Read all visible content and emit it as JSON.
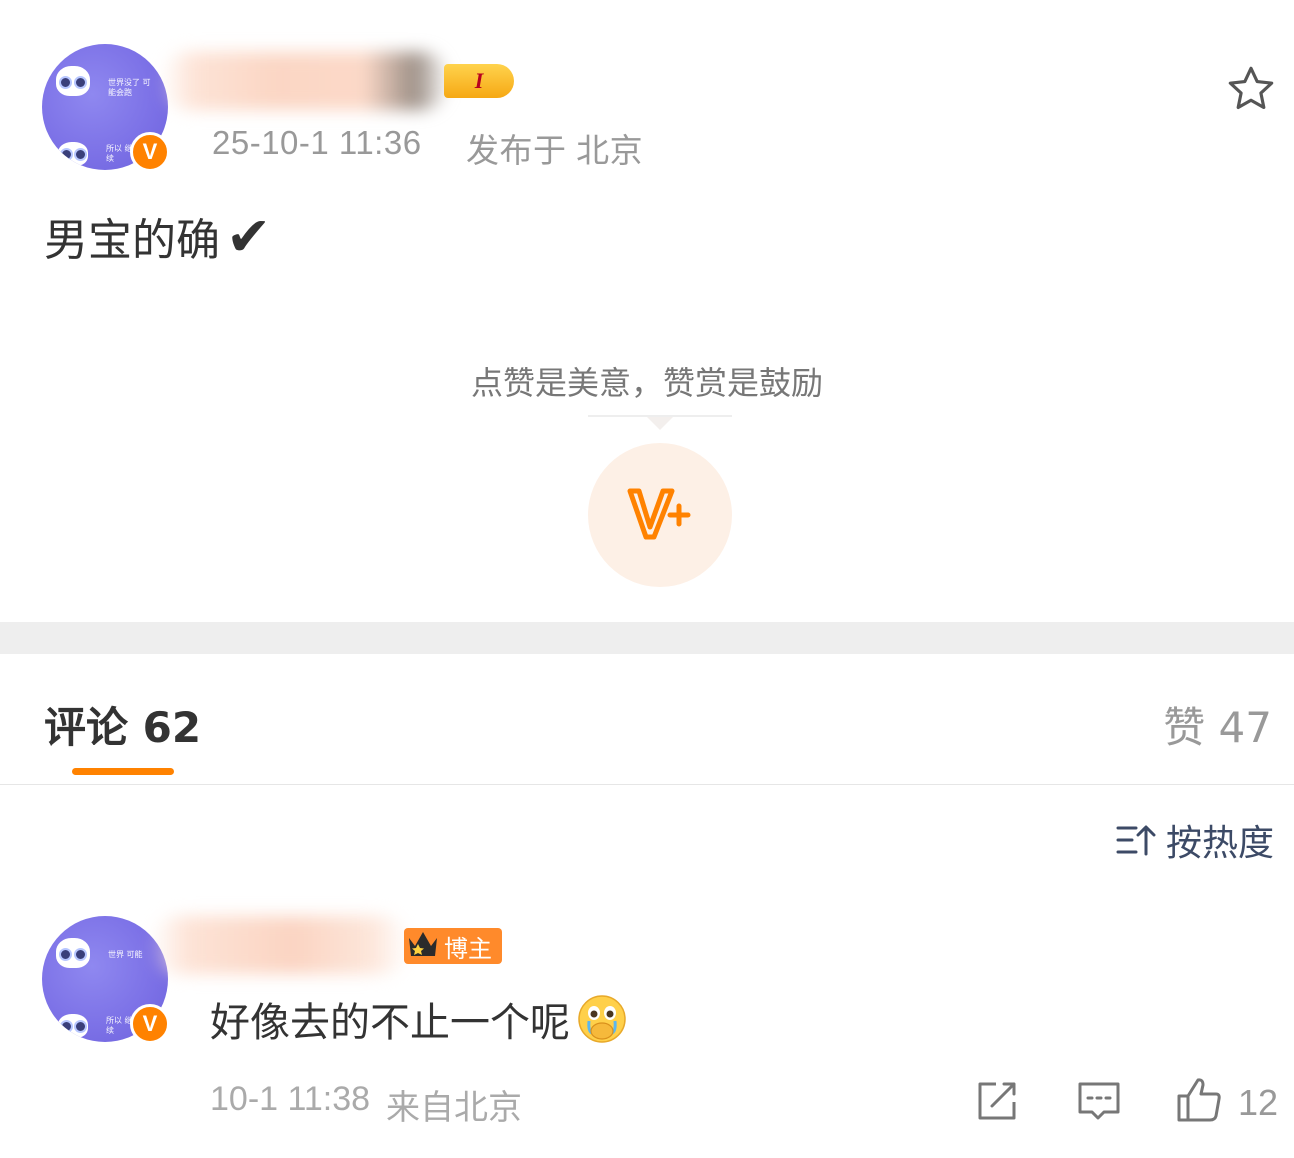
{
  "post": {
    "author_name": "",
    "level_badge": "I",
    "avatar_text_top": "世界没了 可能会跑",
    "avatar_text_bottom": "所以 继续",
    "verified_mark": "V",
    "timestamp": "25-10-1 11:36",
    "location": "发布于 北京",
    "body": "男宝的确",
    "body_emoji": "✔",
    "reward_hint": "点赞是美意，赞赏是鼓励",
    "reward_icon": "V+"
  },
  "tabs": {
    "comments_label": "评论 62",
    "likes_label": "赞 47"
  },
  "sort": {
    "label": "按热度"
  },
  "comments": [
    {
      "author_name": "",
      "badge": "博主",
      "avatar_text_top": "世界 可能",
      "avatar_text_bottom": "所以 继续",
      "verified_mark": "V",
      "text": "好像去的不止一个呢",
      "time": "10-1 11:38",
      "location": "来自北京",
      "like_count": "12"
    }
  ],
  "colors": {
    "accent": "#ff8200",
    "avatar": "#7b70e6"
  }
}
